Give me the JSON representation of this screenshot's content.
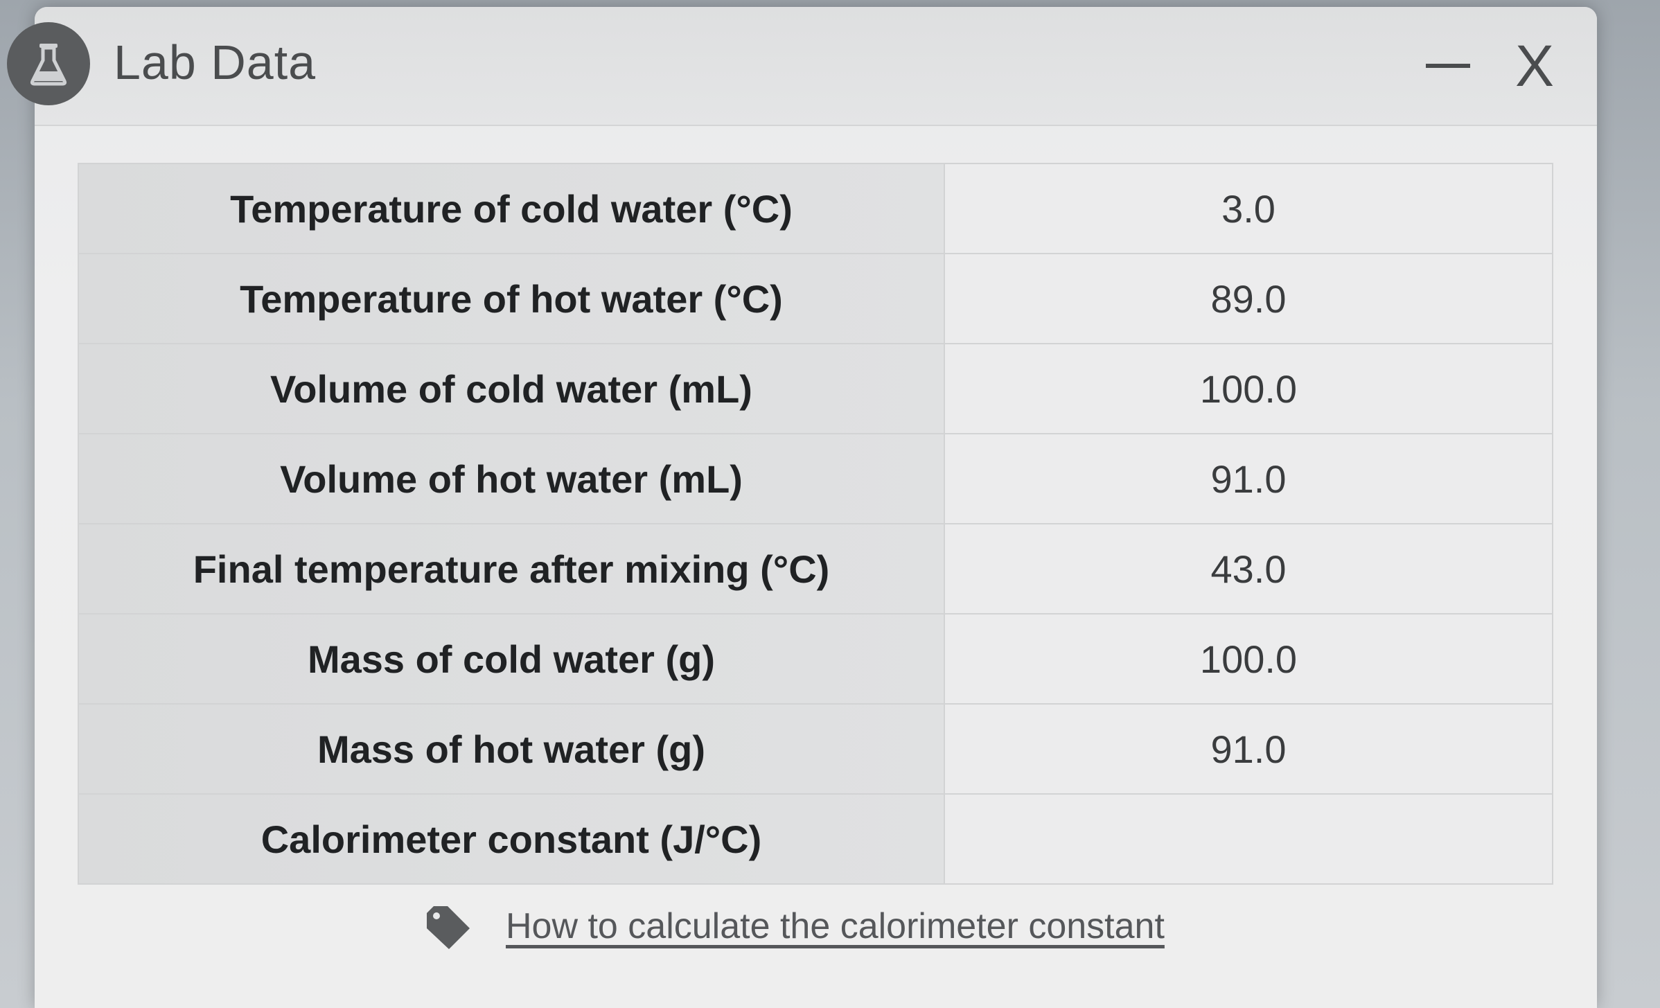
{
  "window": {
    "title": "Lab Data",
    "icon": "flask-icon"
  },
  "table": {
    "rows": [
      {
        "label": "Temperature of cold water (°C)",
        "value": "3.0"
      },
      {
        "label": "Temperature of hot water (°C)",
        "value": "89.0"
      },
      {
        "label": "Volume of cold water (mL)",
        "value": "100.0"
      },
      {
        "label": "Volume of hot water (mL)",
        "value": "91.0"
      },
      {
        "label": "Final temperature after mixing (°C)",
        "value": "43.0"
      },
      {
        "label": "Mass of cold water (g)",
        "value": "100.0"
      },
      {
        "label": "Mass of hot water (g)",
        "value": "91.0"
      },
      {
        "label": "Calorimeter constant (J/°C)",
        "value": ""
      }
    ]
  },
  "hint": {
    "icon": "tag-icon",
    "link_text": "How to calculate the calorimeter constant"
  },
  "controls": {
    "minimize": "minimize-icon",
    "close": "X"
  }
}
